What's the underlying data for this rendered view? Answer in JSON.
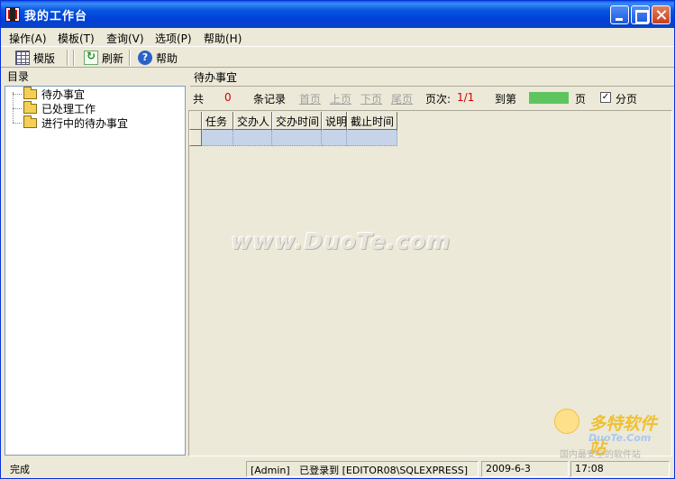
{
  "window": {
    "title": "我的工作台"
  },
  "menu": {
    "items": [
      "操作(A)",
      "模板(T)",
      "查询(V)",
      "选项(P)",
      "帮助(H)"
    ]
  },
  "toolbar": {
    "template_label": "模版",
    "refresh_label": "刷新",
    "help_label": "帮助"
  },
  "left_panel": {
    "header": "目录",
    "tree": [
      "待办事宜",
      "已处理工作",
      "进行中的待办事宜"
    ]
  },
  "right_panel": {
    "header": "待办事宜",
    "pager": {
      "total_prefix": "共",
      "total_count": "0",
      "total_suffix": "条记录",
      "first": "首页",
      "prev": "上页",
      "next": "下页",
      "last": "尾页",
      "page_label": "页次:",
      "page_value": "1/1",
      "goto_label": "到第",
      "goto_suffix": "页",
      "paging_label": "分页",
      "paging_checked": true
    },
    "grid": {
      "columns": [
        "任务",
        "交办人",
        "交办时间",
        "说明",
        "截止时间"
      ]
    }
  },
  "watermark": {
    "text": "www.DuoTe.com",
    "logo_name": "多特软件站",
    "logo_site": "DuoTe.Com",
    "logo_slogan": "国内最安全的软件站"
  },
  "statusbar": {
    "status": "完成",
    "user": "[Admin]",
    "login": "已登录到 [EDITOR08\\SQLEXPRESS]",
    "date": "2009-6-3",
    "time": "17:08"
  },
  "colors": {
    "titlebar": "#0040d8",
    "page_box": "#5ec55e",
    "grid_row": "#c6d3e8"
  }
}
